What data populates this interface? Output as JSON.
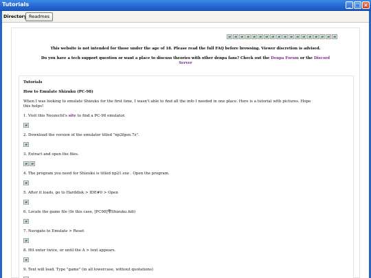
{
  "window": {
    "title": "Tutorials"
  },
  "toolbar": {
    "directory_label": "Directory",
    "readme_label": "Readmes"
  },
  "notices": {
    "age_warning": "This website is not intended for those under the age of 18. Please read the full FAQ before browsing. Viewer discretion is advised.",
    "support_prefix": "Do you have a tech support question or want a place to discuss theories with other denpa fans? Check out the ",
    "forum_link": "Denpa Forum",
    "support_middle": " or the ",
    "discord_link": "Discord",
    "server_label": "Server"
  },
  "article": {
    "section": "Tutorials",
    "heading": "How to Emulate Shizuku (PC-98)",
    "intro": "When I was looking to emulate Shizuku for the first time, I wasn't able to find all the info I needed in one place. Here is a tutorial with pictures. Hope",
    "intro_cont": "this helps!",
    "steps": [
      {
        "pre": "1. Visit this Neozecht's ",
        "link": "site",
        "post": " to find a PC-98 emulator."
      },
      {
        "pre": "2. Download the version of the emulator titled \"np2fgen.7z\".",
        "link": "",
        "post": ""
      },
      {
        "pre": "3. Extract and open the files.",
        "link": "",
        "post": ""
      },
      {
        "pre": "4. The program you need for Shizuku is titled np21.exe . Open the program.",
        "link": "",
        "post": ""
      },
      {
        "pre": "5. After it loads, go to Harddisk > IDE#0 > Open",
        "link": "",
        "post": ""
      },
      {
        "pre": "6. Locate the game file (In this case, [PC98]雫Shizuku.hdi)",
        "link": "",
        "post": ""
      },
      {
        "pre": "7. Navigate to Emulate > Reset",
        "link": "",
        "post": ""
      },
      {
        "pre": "8. Hit enter twice, or until the A > text appears.",
        "link": "",
        "post": ""
      },
      {
        "pre": "9. Text will load. Type \"game\" (in all lowercase, without quotations)",
        "link": "",
        "post": ""
      }
    ]
  },
  "icons": {
    "minimize": "minimize-icon",
    "maximize": "maximize-icon",
    "close": "close-icon",
    "broken_image": "broken-image-icon"
  },
  "colors": {
    "titlebar": "#2467d0",
    "link_purple": "#7a2a8a"
  }
}
